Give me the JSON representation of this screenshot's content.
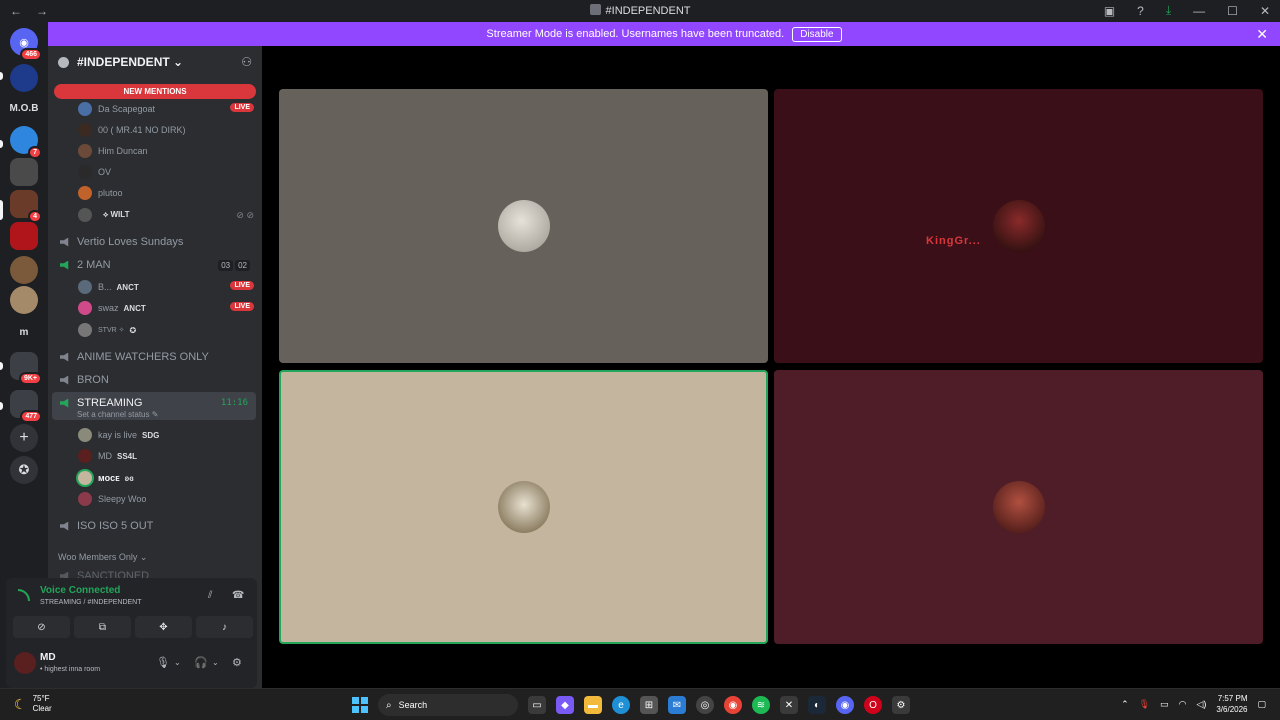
{
  "window": {
    "title": "#INDEPENDENT",
    "back": "←",
    "forward": "→",
    "controls": {
      "minimize": "—",
      "maximize": "☐",
      "close": "✕"
    }
  },
  "banner": {
    "text": "Streamer Mode is enabled. Usernames have been truncated.",
    "disable_label": "Disable",
    "close": "✕"
  },
  "servers": [
    {
      "label": "466",
      "icon": "discord-home-icon"
    },
    {
      "label": "",
      "icon": "server"
    },
    {
      "label": "M.O.B",
      "icon": "server-text"
    },
    {
      "label": "7",
      "icon": "server"
    },
    {
      "label": "",
      "icon": "server"
    },
    {
      "label": "4",
      "icon": "server"
    },
    {
      "label": "",
      "icon": "server"
    },
    {
      "label": "",
      "icon": "server"
    },
    {
      "label": "",
      "icon": "server"
    },
    {
      "label": "m",
      "icon": "server-text"
    },
    {
      "label": "9K+",
      "icon": "server-folder"
    },
    {
      "label": "477",
      "icon": "server-folder"
    }
  ],
  "sidebar": {
    "guild_name": "#INDEPENDENT ⌄",
    "new_mentions": "NEW MENTIONS",
    "channels": {
      "vertio": "Vertio Loves Sundays",
      "two_man": "2 MAN",
      "two_man_count_a": "03",
      "two_man_count_b": "02",
      "anime": "ANIME WATCHERS ONLY",
      "bron": "BRON",
      "streaming": "STREAMING",
      "streaming_status": "Set a channel status ✎",
      "streaming_timer": "11:16",
      "iso": "ISO ISO 5 OUT",
      "category_woo": "Woo Members Only ⌄",
      "sanctioned": "SANCTIONED"
    },
    "users_top": [
      {
        "name": "Da Scapegoat",
        "tag": "",
        "live": "LIVE"
      },
      {
        "name": "00 ( MR.41 NO DIRK)",
        "tag": "",
        "live": ""
      },
      {
        "name": "Him Duncan",
        "tag": "",
        "live": ""
      },
      {
        "name": "OV",
        "tag": "",
        "live": ""
      },
      {
        "name": "plutoo",
        "tag": "",
        "live": ""
      },
      {
        "name": "",
        "tag": "⟡ WILT",
        "live": ""
      }
    ],
    "users_2man": [
      {
        "name": "B...",
        "tag": "ANCT",
        "live": "LIVE"
      },
      {
        "name": "swaz",
        "tag": "ANCT",
        "live": "LIVE"
      },
      {
        "name": "STVR ✧",
        "tag": "✪",
        "live": ""
      }
    ],
    "users_streaming": [
      {
        "name": "kay is live",
        "tag": "SDG"
      },
      {
        "name": "MD",
        "tag": "SS4L"
      },
      {
        "name": "ᴍᴏᴄᴇ",
        "tag": "ʚɞ"
      },
      {
        "name": "Sleepy Woo",
        "tag": ""
      }
    ]
  },
  "voice_panel": {
    "title": "Voice Connected",
    "subtitle": "STREAMING / #INDEPENDENT"
  },
  "user_panel": {
    "name": "MD",
    "status": "• highest inna room"
  },
  "stage": {
    "tile2_name": "KingGr..."
  },
  "taskbar": {
    "temperature": "75°F",
    "condition": "Clear",
    "search_label": "Search",
    "time": "7:57 PM",
    "date": "3/6/2026"
  },
  "colors": {
    "banner": "#9146ff",
    "voice_green": "#23a55a",
    "live_red": "#da373c"
  }
}
